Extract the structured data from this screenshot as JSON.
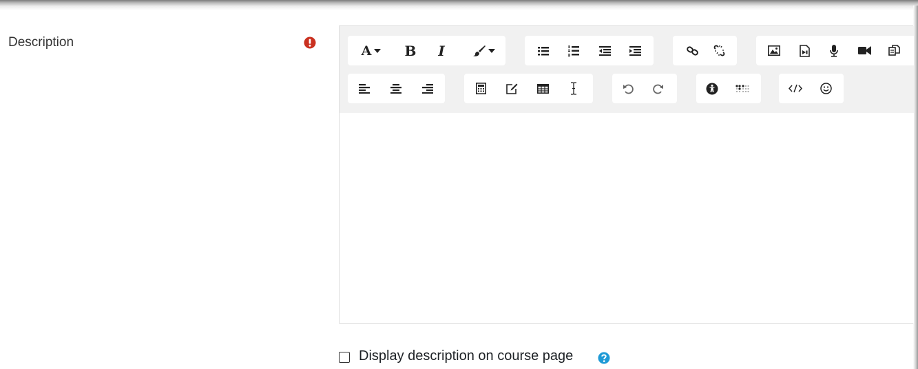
{
  "form": {
    "description_label": "Description",
    "display_description_label": "Display description on course page"
  },
  "toolbar": {
    "font_button_label": "A",
    "bold_label": "B",
    "italic_label": "I"
  },
  "editor": {
    "content": ""
  },
  "colors": {
    "required": "#ca3120",
    "help": "#1f9ad6",
    "toolbar_bg": "#f1f1f1"
  }
}
